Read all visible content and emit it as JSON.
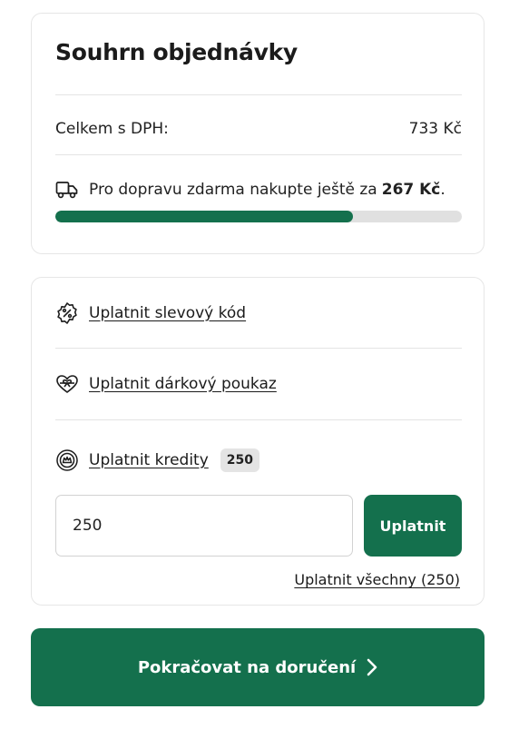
{
  "summary": {
    "title": "Souhrn objednávky",
    "total_label": "Celkem s DPH:",
    "total_value": "733 Kč",
    "shipping_text": "Pro dopravu zdarma nakupte ještě za",
    "shipping_amount": "267 Kč",
    "shipping_suffix": ".",
    "shipping_progress": 0.733,
    "icon": "truck-icon"
  },
  "discounts": {
    "coupon_label": "Uplatnit slevový kód",
    "coupon_icon": "discount-badge-icon",
    "gift_label": "Uplatnit dárkový poukaz",
    "gift_icon": "gift-heart-icon",
    "credits_label": "Uplatnit kredity",
    "credits_icon": "credits-coin-icon",
    "credits_badge": "250",
    "credits_input_value": "250",
    "apply_label": "Uplatnit",
    "apply_all_label": "Uplatnit všechny (250)"
  },
  "footer": {
    "continue_label": "Pokračovat na doručení",
    "continue_icon": "chevron-right-icon"
  },
  "colors": {
    "brand": "#14704d",
    "track": "#e0e0e0",
    "border": "#e6e6e6"
  }
}
